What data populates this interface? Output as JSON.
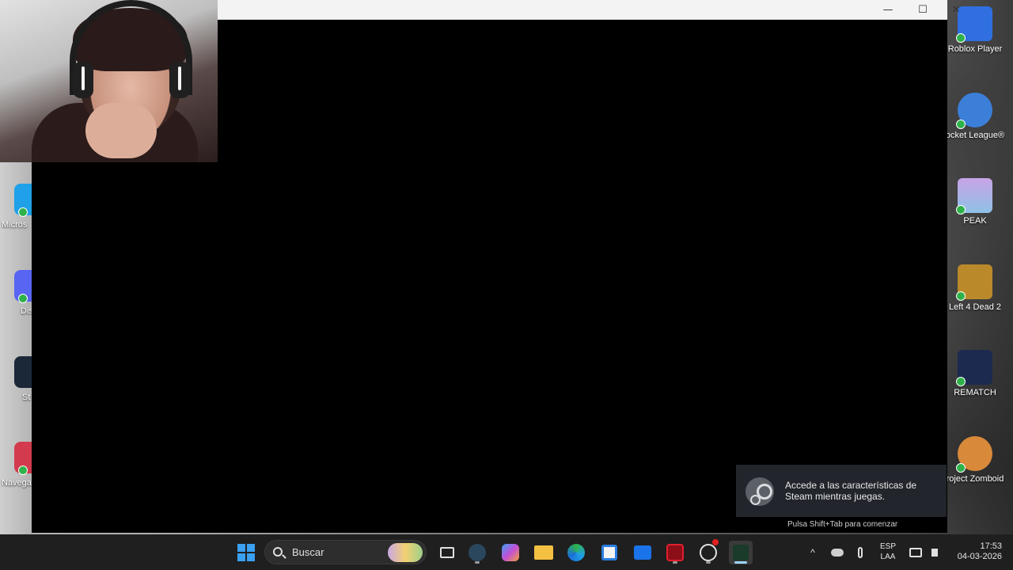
{
  "desktop": {
    "right_icons": [
      {
        "label": "Roblox Player",
        "color": "#2f6fe0"
      },
      {
        "label": "ocket League®",
        "color": "#3b7fd8"
      },
      {
        "label": "PEAK",
        "color": "#8ec1e6"
      },
      {
        "label": "Left 4 Dead 2",
        "color": "#b9892a"
      },
      {
        "label": "REMATCH",
        "color": "#1c2a4f"
      },
      {
        "label": "roject Zomboid",
        "color": "#d8893a"
      }
    ],
    "left_icons": [
      {
        "label": "Micros",
        "color": "#1fa0e8"
      },
      {
        "label": "Dis",
        "color": "#5865f2"
      },
      {
        "label": "St",
        "color": "#1b2838"
      },
      {
        "label": "Navega",
        "color": "#d43a4d"
      }
    ]
  },
  "window": {
    "minimize_glyph": "—",
    "maximize_glyph": "☐",
    "close_glyph": "✕"
  },
  "steam_toast": {
    "message": "Accede a las características de Steam mientras juegas.",
    "hint": "Pulsa Shift+Tab para comenzar"
  },
  "taskbar": {
    "search_placeholder": "Buscar",
    "language_top": "ESP",
    "language_bottom": "LAA",
    "time": "17:53",
    "date": "04-03-2026",
    "tray_chevron": "^"
  },
  "colors": {
    "accent": "#3aa0f2",
    "taskbar_bg": "#1f1f1f"
  }
}
